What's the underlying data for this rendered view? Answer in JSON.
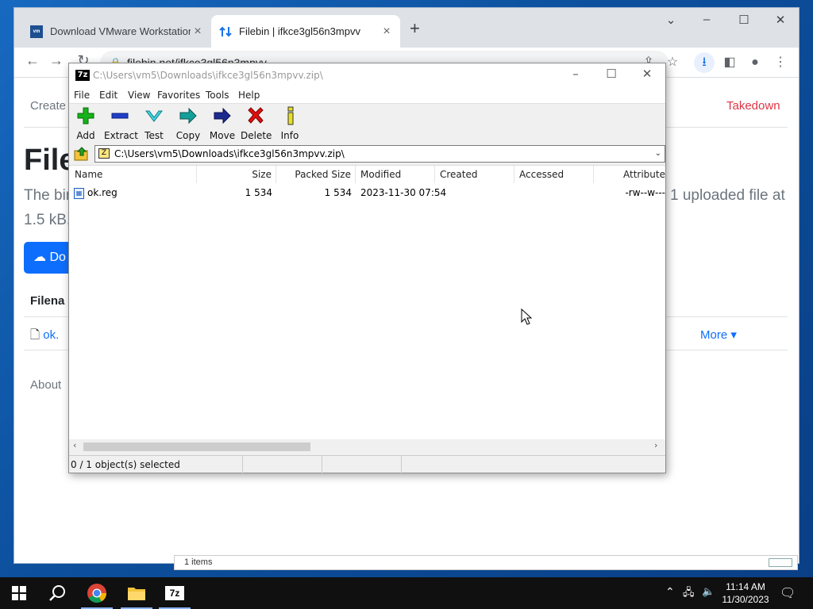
{
  "browser": {
    "tabs": [
      {
        "title": "Download VMware Workstation"
      },
      {
        "title": "Filebin | ifkce3gl56n3mpvv"
      }
    ],
    "url": "filebin.net/ifkce3gl56n3mpvv"
  },
  "filebin": {
    "nav_create": "Create",
    "nav_takedown": "Takedown",
    "heading": "File",
    "desc_start": "The bin",
    "desc_end": "1 uploaded file at",
    "desc_line2": "1.5 kB.",
    "download_button": "Do",
    "filename_header": "Filena",
    "file_link": "ok.",
    "more_label": "More",
    "footer_about": "About"
  },
  "background_window": {
    "status_text": "1 items"
  },
  "sevenzip": {
    "title": "C:\\Users\\vm5\\Downloads\\ifkce3gl56n3mpvv.zip\\",
    "menu": [
      "File",
      "Edit",
      "View",
      "Favorites",
      "Tools",
      "Help"
    ],
    "toolbar": [
      "Add",
      "Extract",
      "Test",
      "Copy",
      "Move",
      "Delete",
      "Info"
    ],
    "address": "C:\\Users\\vm5\\Downloads\\ifkce3gl56n3mpvv.zip\\",
    "columns": [
      "Name",
      "Size",
      "Packed Size",
      "Modified",
      "Created",
      "Accessed",
      "Attribute"
    ],
    "rows": [
      {
        "name": "ok.reg",
        "size": "1 534",
        "packed": "1 534",
        "modified": "2023-11-30 07:54",
        "created": "",
        "accessed": "",
        "attr": "-rw--w---"
      }
    ],
    "status": "0 / 1 object(s) selected"
  },
  "taskbar": {
    "time": "11:14 AM",
    "date": "11/30/2023",
    "apps": [
      "start-button",
      "search",
      "chrome",
      "file-explorer",
      "7-zip"
    ],
    "sevenzip_label": "7z"
  },
  "colors": {
    "accent": "#0d6efd",
    "danger": "#dc3545"
  }
}
